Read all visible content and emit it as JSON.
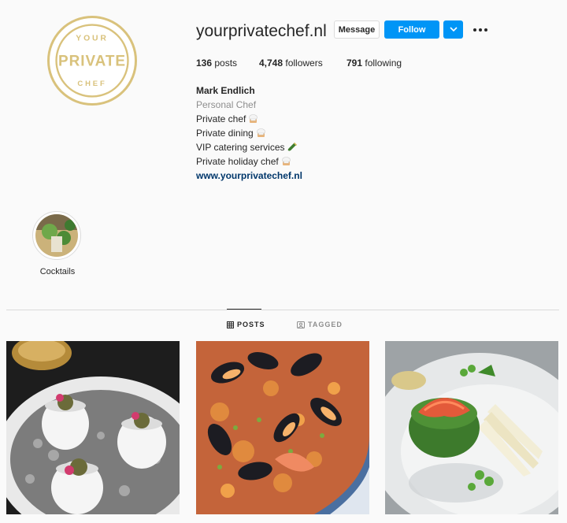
{
  "profile": {
    "username": "yourprivatechef.nl",
    "logo_text": {
      "top": "YOUR",
      "middle": "PRIVATE",
      "bottom": "CHEF"
    }
  },
  "actions": {
    "message_label": "Message",
    "follow_label": "Follow"
  },
  "stats": {
    "posts": {
      "count": "136",
      "label": "posts"
    },
    "followers": {
      "count": "4,748",
      "label": "followers"
    },
    "following": {
      "count": "791",
      "label": "following"
    }
  },
  "bio": {
    "name": "Mark Endlich",
    "category": "Personal Chef",
    "lines": [
      "Private chef",
      "Private dining",
      "VIP catering services",
      "Private holiday chef"
    ],
    "website": "www.yourprivatechef.nl"
  },
  "highlights": [
    {
      "label": "Cocktails"
    }
  ],
  "tabs": [
    {
      "label": "POSTS",
      "icon": "grid-icon",
      "active": true
    },
    {
      "label": "TAGGED",
      "icon": "tagged-icon",
      "active": false
    }
  ],
  "colors": {
    "accent": "#0095f6",
    "gold": "#d9c27c",
    "link": "#00376b"
  }
}
